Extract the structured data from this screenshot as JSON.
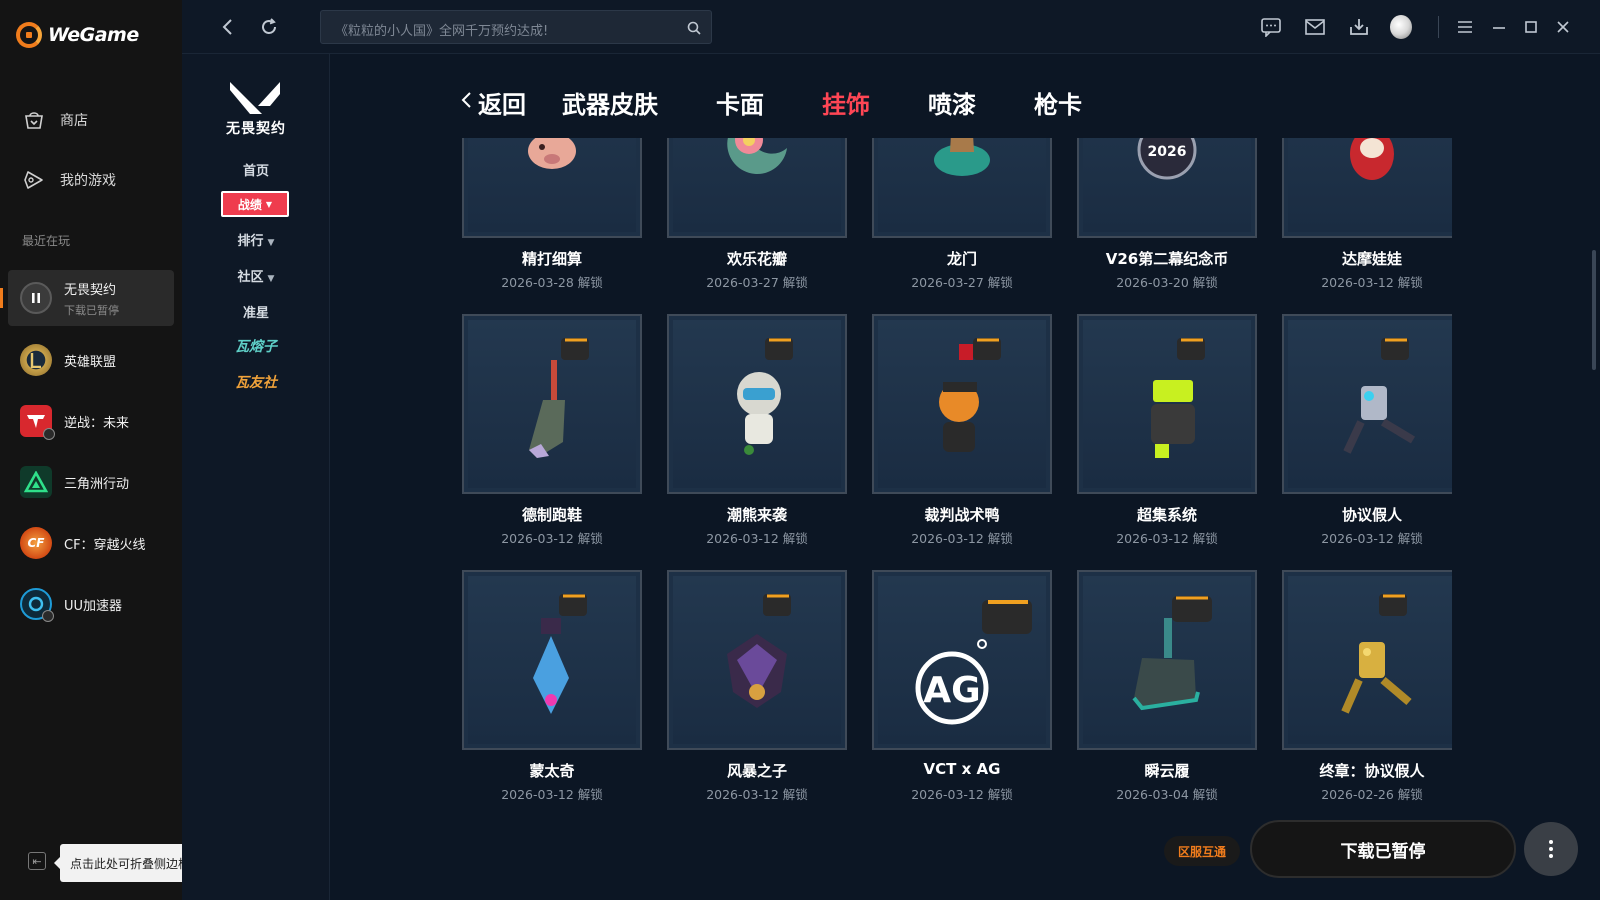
{
  "app": {
    "brand": "WeGame"
  },
  "sidebar": {
    "nav": [
      {
        "label": "商店",
        "icon": "shop-bag-icon"
      },
      {
        "label": "我的游戏",
        "icon": "gamepad-icon"
      }
    ],
    "recent_label": "最近在玩",
    "recent": [
      {
        "name": "无畏契约",
        "sub": "下载已暂停",
        "icon": "pause-icon",
        "color": "#3b3b3b"
      },
      {
        "name": "英雄联盟",
        "sub": "",
        "icon": "lol-icon",
        "color": "#c8a24a"
      },
      {
        "name": "逆战：未来",
        "sub": "",
        "icon": "nizhan-icon",
        "color": "#d8282e"
      },
      {
        "name": "三角洲行动",
        "sub": "",
        "icon": "delta-icon",
        "color": "#1fbf6a"
      },
      {
        "name": "CF：穿越火线",
        "sub": "",
        "icon": "cf-icon",
        "color": "#e25a1c"
      },
      {
        "name": "UU加速器",
        "sub": "",
        "icon": "uu-icon",
        "color": "#1e9bd7"
      }
    ],
    "collapse_tooltip": "点击此处可折叠侧边栏"
  },
  "topbar": {
    "search_placeholder": "《粒粒的小人国》全网千万预约达成!"
  },
  "subnav": {
    "title": "无畏契约",
    "items": [
      {
        "label": "首页",
        "dropdown": false
      },
      {
        "label": "战绩",
        "dropdown": true,
        "active": true
      },
      {
        "label": "排行",
        "dropdown": true
      },
      {
        "label": "社区",
        "dropdown": true
      },
      {
        "label": "准星",
        "dropdown": false
      }
    ],
    "badges": [
      {
        "label": "瓦熔子",
        "color": "#5fd0c8"
      },
      {
        "label": "瓦友社",
        "color": "#f0a23a"
      }
    ]
  },
  "main": {
    "back_label": "返回",
    "tabs": [
      "武器皮肤",
      "卡面",
      "挂饰",
      "喷漆",
      "枪卡"
    ],
    "active_tab": "挂饰",
    "items": [
      {
        "name": "精打细算",
        "date": "2026-03-28 解锁",
        "art": "piggy-bank-charm"
      },
      {
        "name": "欢乐花瓣",
        "date": "2026-03-27 解锁",
        "art": "flower-moon-charm"
      },
      {
        "name": "龙门",
        "date": "2026-03-27 解锁",
        "art": "dragon-gate-charm"
      },
      {
        "name": "V26第二幕纪念币",
        "date": "2026-03-20 解锁",
        "art": "coin-charm"
      },
      {
        "name": "达摩娃娃",
        "date": "2026-03-12 解锁",
        "art": "daruma-charm"
      },
      {
        "name": "德制跑鞋",
        "date": "2026-03-12 解锁",
        "art": "sneaker-charm"
      },
      {
        "name": "潮熊来袭",
        "date": "2026-03-12 解锁",
        "art": "bear-charm"
      },
      {
        "name": "裁判战术鸭",
        "date": "2026-03-12 解锁",
        "art": "duck-charm"
      },
      {
        "name": "超集系统",
        "date": "2026-03-12 解锁",
        "art": "robot-charm"
      },
      {
        "name": "协议假人",
        "date": "2026-03-12 解锁",
        "art": "dummy-charm"
      },
      {
        "name": "蒙太奇",
        "date": "2026-03-12 解锁",
        "art": "crystal-charm"
      },
      {
        "name": "风暴之子",
        "date": "2026-03-12 解锁",
        "art": "storm-charm"
      },
      {
        "name": "VCT x AG",
        "date": "2026-03-12 解锁",
        "art": "ag-logo-charm"
      },
      {
        "name": "瞬云履",
        "date": "2026-03-04 解锁",
        "art": "shoe-charm"
      },
      {
        "name": "终章：协议假人",
        "date": "2026-02-26 解锁",
        "art": "gold-dummy-charm"
      }
    ]
  },
  "bottom": {
    "region_badge": "区服互通",
    "download_label": "下载已暂停"
  },
  "colors": {
    "accent_red": "#ff4655",
    "brand_orange": "#f07c1c"
  }
}
